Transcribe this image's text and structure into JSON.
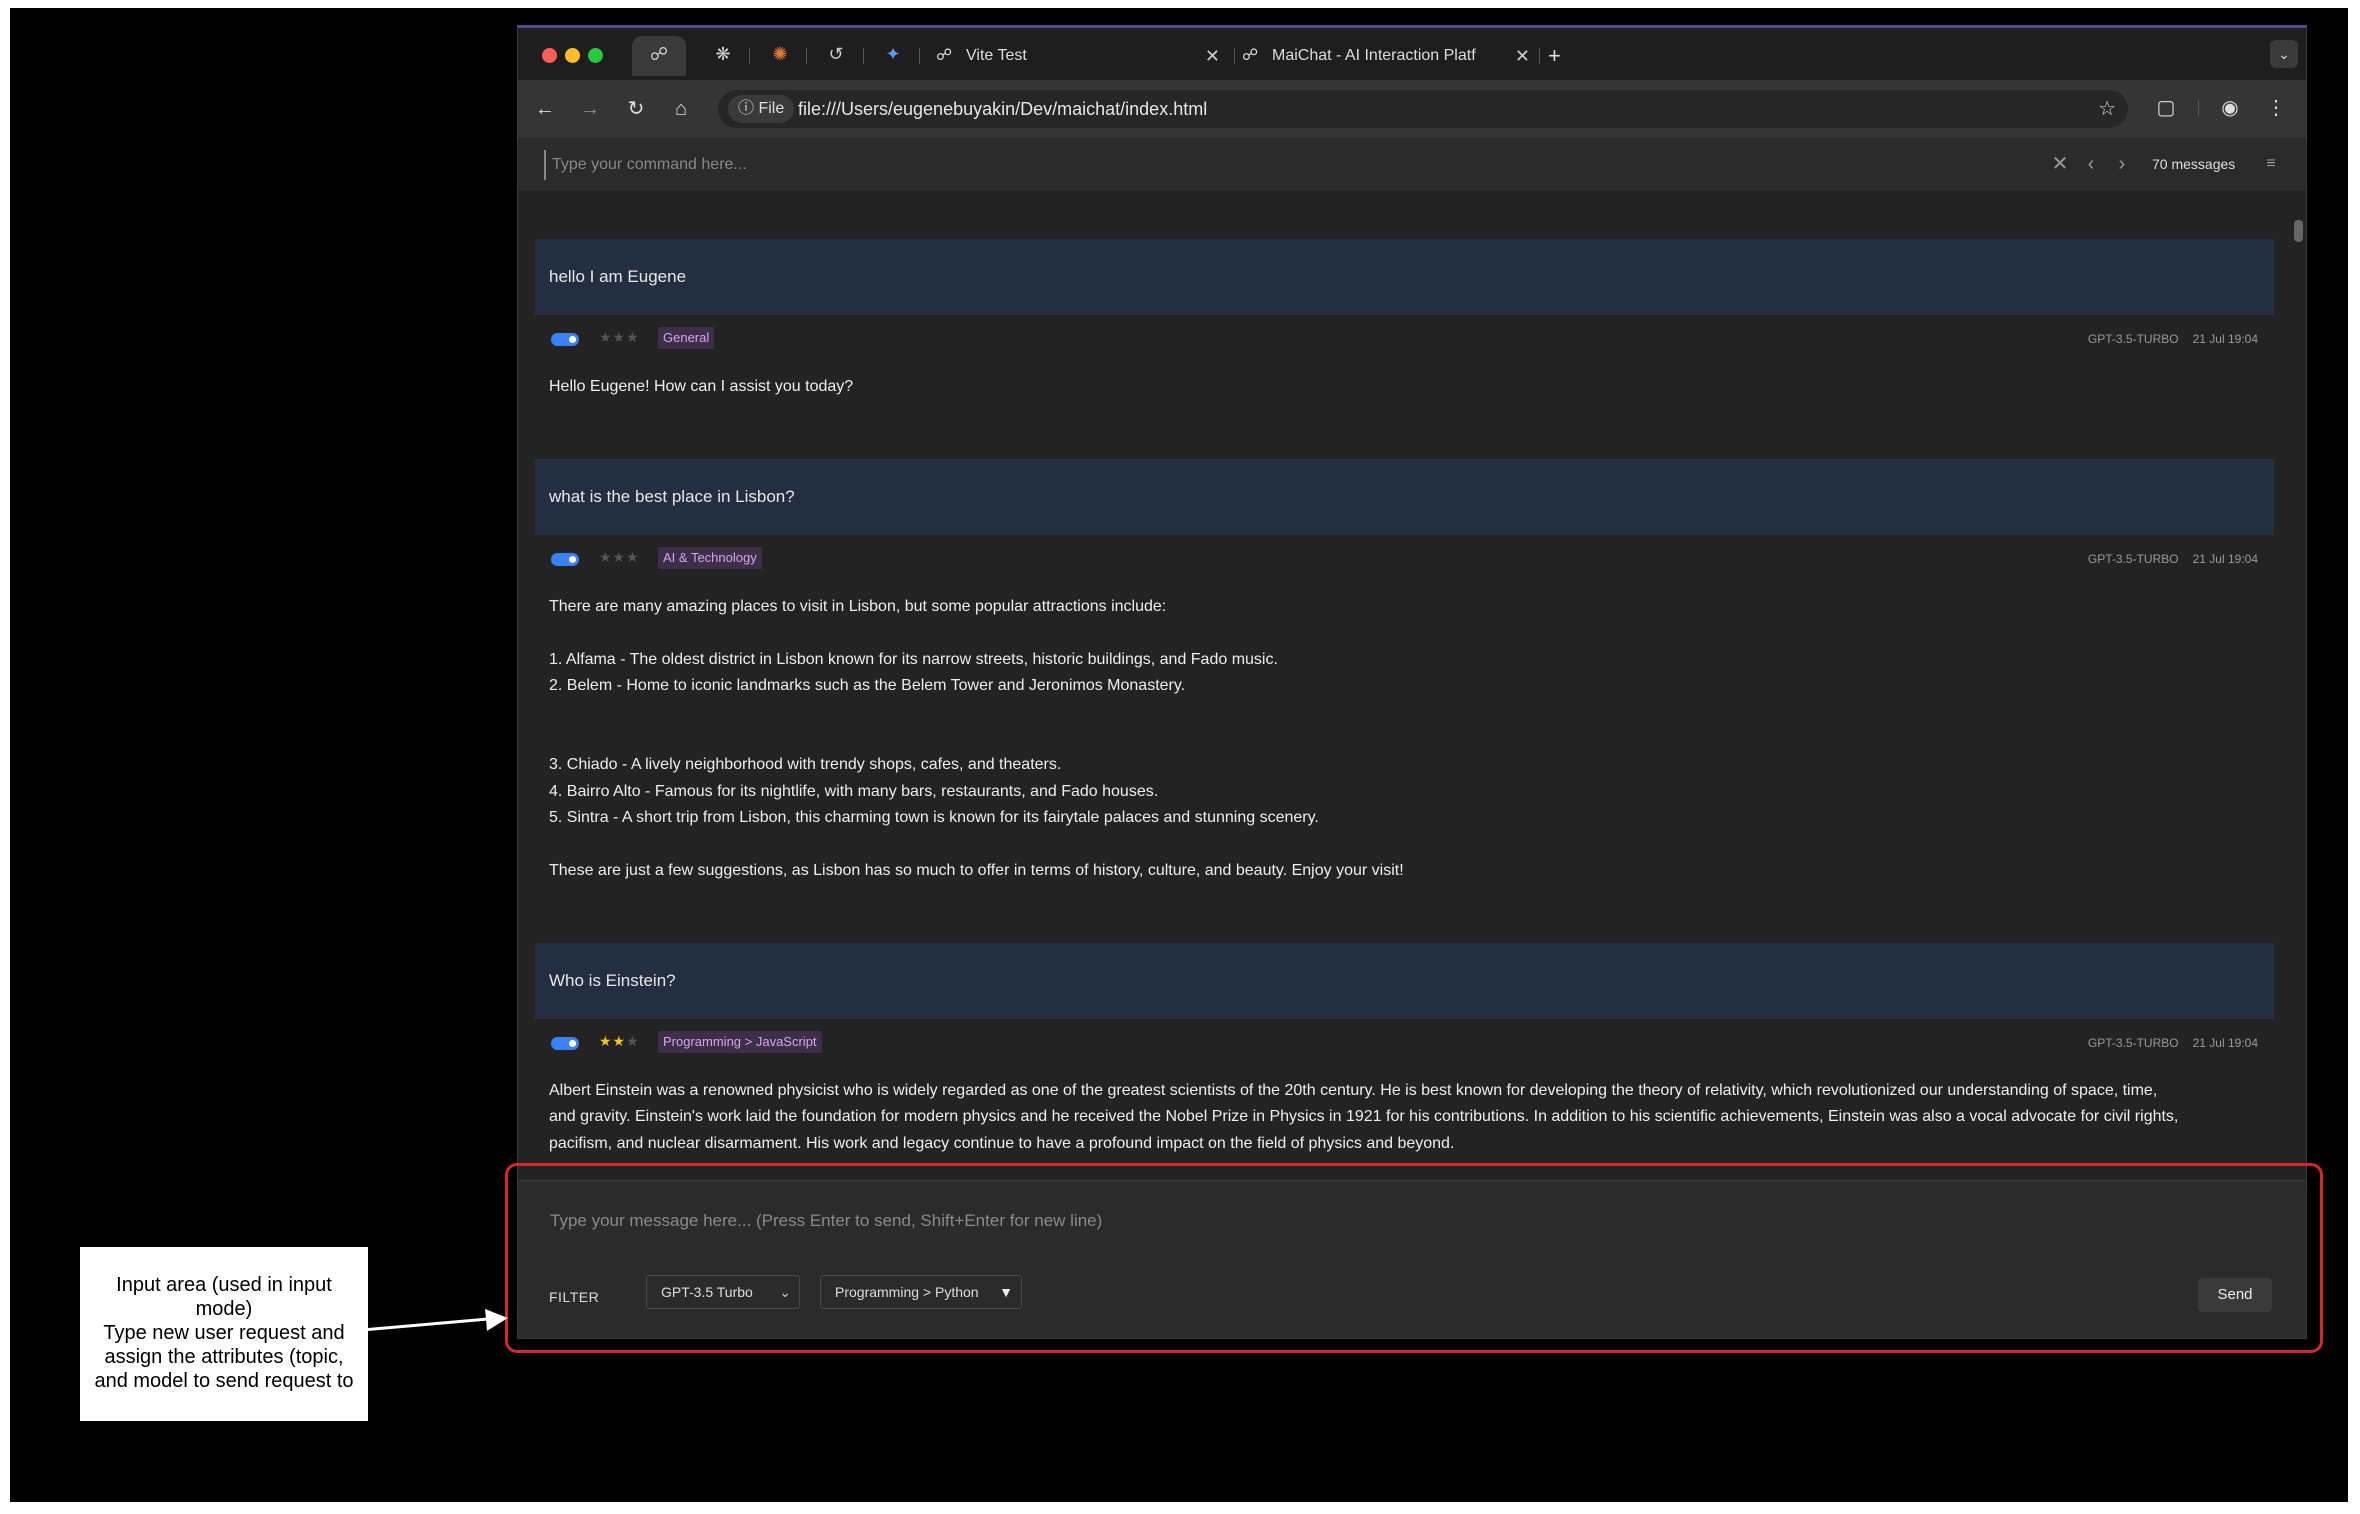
{
  "browser": {
    "tabs": [
      {
        "label": "Vite Test"
      },
      {
        "label": "MaiChat - AI Interaction Platf"
      }
    ],
    "new_tab": "+",
    "file_chip": "File",
    "url": "file:///Users/eugenebuyakin/Dev/maichat/index.html"
  },
  "command_bar": {
    "placeholder": "Type your command here...",
    "message_count": "70 messages"
  },
  "conversation": [
    {
      "user": "hello I am Eugene",
      "stars": 0,
      "topic": "General",
      "model": "GPT-3.5-TURBO",
      "date": "21 Jul 19:04",
      "answer": [
        "Hello Eugene! How can I assist you today?"
      ]
    },
    {
      "user": "what is the best place in Lisbon?",
      "stars": 0,
      "topic": "AI & Technology",
      "model": "GPT-3.5-TURBO",
      "date": "21 Jul 19:04",
      "answer": [
        "There are many amazing places to visit in Lisbon, but some popular attractions include:",
        "",
        "1. Alfama - The oldest district in Lisbon known for its narrow streets, historic buildings, and Fado music.",
        "2. Belem - Home to iconic landmarks such as the Belem Tower and Jeronimos Monastery.",
        "",
        "",
        "3. Chiado - A lively neighborhood with trendy shops, cafes, and theaters.",
        "4. Bairro Alto - Famous for its nightlife, with many bars, restaurants, and Fado houses.",
        "5. Sintra - A short trip from Lisbon, this charming town is known for its fairytale palaces and stunning scenery.",
        "",
        "These are just a few suggestions, as Lisbon has so much to offer in terms of history, culture, and beauty. Enjoy your visit!"
      ]
    },
    {
      "user": "Who is Einstein?",
      "stars": 2,
      "topic": "Programming > JavaScript",
      "model": "GPT-3.5-TURBO",
      "date": "21 Jul 19:04",
      "answer": [
        "Albert Einstein was a renowned physicist who is widely regarded as one of the greatest scientists of the 20th century. He is best known for developing the theory of relativity, which revolutionized our understanding of space, time,",
        "and gravity. Einstein's work laid the foundation for modern physics and he received the Nobel Prize in Physics in 1921 for his contributions. In addition to his scientific achievements, Einstein was also a vocal advocate for civil rights,",
        "pacifism, and nuclear disarmament. His work and legacy continue to have a profound impact on the field of physics and beyond."
      ]
    }
  ],
  "input_area": {
    "placeholder": "Type your message here... (Press Enter to send, Shift+Enter for new line)",
    "filter_label": "FILTER",
    "model_select": "GPT-3.5 Turbo",
    "topic_select": "Programming > Python",
    "send_label": "Send"
  },
  "annotation": {
    "lines": [
      "Input area (used in input",
      "mode)",
      "Type new user request and",
      "assign the attributes (topic,",
      "and model to send request to"
    ]
  },
  "colors": {
    "user_bubble": "#232e40",
    "topic_text": "#d4a6e8",
    "star_active": "#f2c12e",
    "toggle": "#3b82f6",
    "highlight": "#d02a2a"
  }
}
